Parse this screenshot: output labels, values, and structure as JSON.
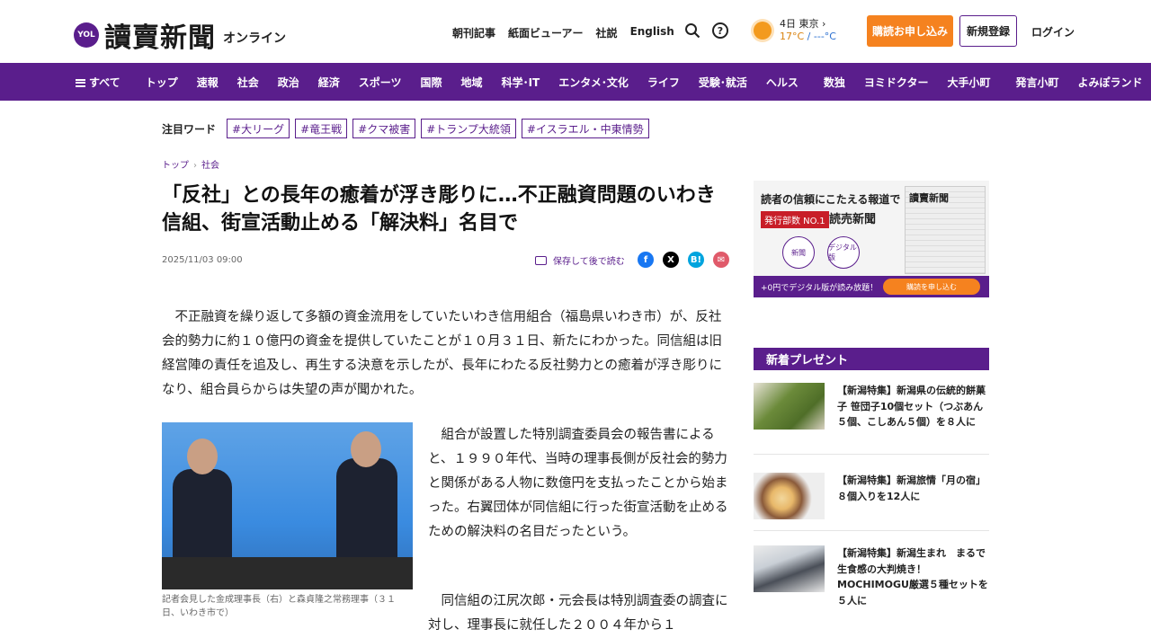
{
  "header": {
    "logo_badge": "YOL",
    "logo_name": "讀賣新聞",
    "logo_sub": "オンライン",
    "links": [
      "朝刊記事",
      "紙面ビューアー",
      "社説",
      "English"
    ],
    "weather_line1": "4日 東京 ›",
    "weather_temp_hi": "17°C",
    "weather_temp_lo": " / ---°C",
    "subscribe_label": "購読お申し込み",
    "register_label": "新規登録",
    "login_label": "ログイン"
  },
  "nav": {
    "items": [
      "すべて",
      "トップ",
      "速報",
      "社会",
      "政治",
      "経済",
      "スポーツ",
      "国際",
      "地域",
      "科学･IT",
      "エンタメ･文化",
      "ライフ",
      "受験･就活",
      "ヘルス",
      "数独",
      "ヨミドクター",
      "大手小町",
      "発言小町",
      "よみぽランド"
    ]
  },
  "hotwords": {
    "label": "注目ワード",
    "tags": [
      "#大リーグ",
      "#竜王戦",
      "#クマ被害",
      "#トランプ大統領",
      "#イスラエル・中東情勢"
    ]
  },
  "breadcrumb": {
    "top": "トップ",
    "sep": "›",
    "section": "社会"
  },
  "article": {
    "title": "「反社」との長年の癒着が浮き彫りに…不正融資問題のいわき信組、街宣活動止める「解決料」名目で",
    "date": "2025/11/03 09:00",
    "save_label": "保存して後で読む",
    "p1": "　不正融資を繰り返して多額の資金流用をしていたいわき信用組合（福島県いわき市）が、反社会的勢力に約１０億円の資金を提供していたことが１０月３１日、新たにわかった。同信組は旧経営陣の責任を追及し、再生する決意を示したが、長年にわたる反社勢力との癒着が浮き彫りになり、組合員らからは失望の声が聞かれた。",
    "p2": "　組合が設置した特別調査委員会の報告書によると、１９９０年代、当時の理事長側が反社会的勢力と関係がある人物に数億円を支払ったことから始まった。右翼団体が同信組に行った街宣活動を止めるための解決料の名目だったという。",
    "p3": "　同信組の江尻次郎・元会長は特別調査委の調査に対し、理事長に就任した２００４年から１",
    "photo_caption": "記者会見した金成理事長（右）と森貞隆之常務理事（３１日、いわき市で）"
  },
  "share_icons": [
    "facebook-icon",
    "x-icon",
    "hatena-icon",
    "mail-icon"
  ],
  "ad": {
    "headline": "読者の信頼にこたえる報道で",
    "no1": "発行部数 NO.1",
    "brand": "読売新聞",
    "circle1": "新聞",
    "circle2": "デジタル版",
    "paper_title": "讀賣新聞",
    "bottom_text": "+0円でデジタル版が読み放題！",
    "button": "購読を申し込む"
  },
  "presents": {
    "heading": "新着プレゼント",
    "items": [
      "【新潟特集】新潟県の伝統的餅菓子 笹団子10個セット（つぶあん５個、こしあん５個）を８人に",
      "【新潟特集】新潟旅情「月の宿」８個入りを12人に",
      "【新潟特集】新潟生まれ　まるで生食感の大判焼き！MOCHIMOGU厳選５種セットを５人に"
    ]
  },
  "colors": {
    "brand": "#5a1e8c",
    "accent": "#f5821f"
  }
}
